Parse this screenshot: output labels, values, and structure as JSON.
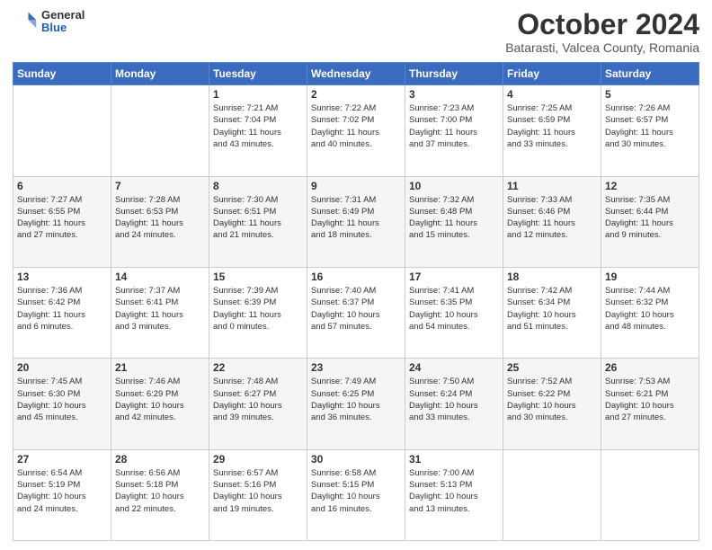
{
  "header": {
    "logo_general": "General",
    "logo_blue": "Blue",
    "month": "October 2024",
    "location": "Batarasti, Valcea County, Romania"
  },
  "weekdays": [
    "Sunday",
    "Monday",
    "Tuesday",
    "Wednesday",
    "Thursday",
    "Friday",
    "Saturday"
  ],
  "weeks": [
    [
      {
        "day": "",
        "info": ""
      },
      {
        "day": "",
        "info": ""
      },
      {
        "day": "1",
        "info": "Sunrise: 7:21 AM\nSunset: 7:04 PM\nDaylight: 11 hours\nand 43 minutes."
      },
      {
        "day": "2",
        "info": "Sunrise: 7:22 AM\nSunset: 7:02 PM\nDaylight: 11 hours\nand 40 minutes."
      },
      {
        "day": "3",
        "info": "Sunrise: 7:23 AM\nSunset: 7:00 PM\nDaylight: 11 hours\nand 37 minutes."
      },
      {
        "day": "4",
        "info": "Sunrise: 7:25 AM\nSunset: 6:59 PM\nDaylight: 11 hours\nand 33 minutes."
      },
      {
        "day": "5",
        "info": "Sunrise: 7:26 AM\nSunset: 6:57 PM\nDaylight: 11 hours\nand 30 minutes."
      }
    ],
    [
      {
        "day": "6",
        "info": "Sunrise: 7:27 AM\nSunset: 6:55 PM\nDaylight: 11 hours\nand 27 minutes."
      },
      {
        "day": "7",
        "info": "Sunrise: 7:28 AM\nSunset: 6:53 PM\nDaylight: 11 hours\nand 24 minutes."
      },
      {
        "day": "8",
        "info": "Sunrise: 7:30 AM\nSunset: 6:51 PM\nDaylight: 11 hours\nand 21 minutes."
      },
      {
        "day": "9",
        "info": "Sunrise: 7:31 AM\nSunset: 6:49 PM\nDaylight: 11 hours\nand 18 minutes."
      },
      {
        "day": "10",
        "info": "Sunrise: 7:32 AM\nSunset: 6:48 PM\nDaylight: 11 hours\nand 15 minutes."
      },
      {
        "day": "11",
        "info": "Sunrise: 7:33 AM\nSunset: 6:46 PM\nDaylight: 11 hours\nand 12 minutes."
      },
      {
        "day": "12",
        "info": "Sunrise: 7:35 AM\nSunset: 6:44 PM\nDaylight: 11 hours\nand 9 minutes."
      }
    ],
    [
      {
        "day": "13",
        "info": "Sunrise: 7:36 AM\nSunset: 6:42 PM\nDaylight: 11 hours\nand 6 minutes."
      },
      {
        "day": "14",
        "info": "Sunrise: 7:37 AM\nSunset: 6:41 PM\nDaylight: 11 hours\nand 3 minutes."
      },
      {
        "day": "15",
        "info": "Sunrise: 7:39 AM\nSunset: 6:39 PM\nDaylight: 11 hours\nand 0 minutes."
      },
      {
        "day": "16",
        "info": "Sunrise: 7:40 AM\nSunset: 6:37 PM\nDaylight: 10 hours\nand 57 minutes."
      },
      {
        "day": "17",
        "info": "Sunrise: 7:41 AM\nSunset: 6:35 PM\nDaylight: 10 hours\nand 54 minutes."
      },
      {
        "day": "18",
        "info": "Sunrise: 7:42 AM\nSunset: 6:34 PM\nDaylight: 10 hours\nand 51 minutes."
      },
      {
        "day": "19",
        "info": "Sunrise: 7:44 AM\nSunset: 6:32 PM\nDaylight: 10 hours\nand 48 minutes."
      }
    ],
    [
      {
        "day": "20",
        "info": "Sunrise: 7:45 AM\nSunset: 6:30 PM\nDaylight: 10 hours\nand 45 minutes."
      },
      {
        "day": "21",
        "info": "Sunrise: 7:46 AM\nSunset: 6:29 PM\nDaylight: 10 hours\nand 42 minutes."
      },
      {
        "day": "22",
        "info": "Sunrise: 7:48 AM\nSunset: 6:27 PM\nDaylight: 10 hours\nand 39 minutes."
      },
      {
        "day": "23",
        "info": "Sunrise: 7:49 AM\nSunset: 6:25 PM\nDaylight: 10 hours\nand 36 minutes."
      },
      {
        "day": "24",
        "info": "Sunrise: 7:50 AM\nSunset: 6:24 PM\nDaylight: 10 hours\nand 33 minutes."
      },
      {
        "day": "25",
        "info": "Sunrise: 7:52 AM\nSunset: 6:22 PM\nDaylight: 10 hours\nand 30 minutes."
      },
      {
        "day": "26",
        "info": "Sunrise: 7:53 AM\nSunset: 6:21 PM\nDaylight: 10 hours\nand 27 minutes."
      }
    ],
    [
      {
        "day": "27",
        "info": "Sunrise: 6:54 AM\nSunset: 5:19 PM\nDaylight: 10 hours\nand 24 minutes."
      },
      {
        "day": "28",
        "info": "Sunrise: 6:56 AM\nSunset: 5:18 PM\nDaylight: 10 hours\nand 22 minutes."
      },
      {
        "day": "29",
        "info": "Sunrise: 6:57 AM\nSunset: 5:16 PM\nDaylight: 10 hours\nand 19 minutes."
      },
      {
        "day": "30",
        "info": "Sunrise: 6:58 AM\nSunset: 5:15 PM\nDaylight: 10 hours\nand 16 minutes."
      },
      {
        "day": "31",
        "info": "Sunrise: 7:00 AM\nSunset: 5:13 PM\nDaylight: 10 hours\nand 13 minutes."
      },
      {
        "day": "",
        "info": ""
      },
      {
        "day": "",
        "info": ""
      }
    ]
  ]
}
